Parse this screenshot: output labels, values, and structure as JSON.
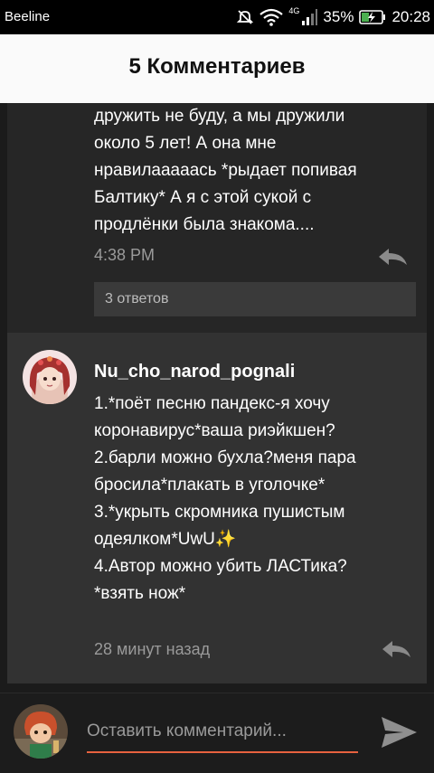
{
  "status_bar": {
    "carrier": "Beeline",
    "network_type": "4G",
    "battery_percent": "35%",
    "time": "20:28"
  },
  "header": {
    "title": "5 Комментариев"
  },
  "previous_comment": {
    "text_lines": [
      "дружить не буду, а мы дружили",
      "около 5 лет!  А она мне",
      "нравилааааась *рыдает попивая",
      "Балтику* А я с этой сукой с",
      "продлёнки была знакома...."
    ],
    "time": "4:38 PM",
    "replies_label": "3 ответов"
  },
  "comment": {
    "username": "Nu_cho_narod_pognali",
    "text_lines": [
      "1.*поёт песню пандекс-я хочу",
      "коронавирус*ваша риэйкшен?",
      "2.барли можно бухла?меня пара",
      "бросила*плакать в уголочке*",
      "3.*укрыть скромника пушистым",
      "одеялком*UwU",
      "4.Автор можно убить ЛАСТика?",
      "*взять нож*"
    ],
    "sparkle_emoji": "✨",
    "time": "28 минут назад"
  },
  "input": {
    "placeholder": "Оставить комментарий..."
  },
  "colors": {
    "accent": "#e7623f",
    "background": "#1b1b1b",
    "card": "#323232",
    "header": "#fafafa"
  }
}
